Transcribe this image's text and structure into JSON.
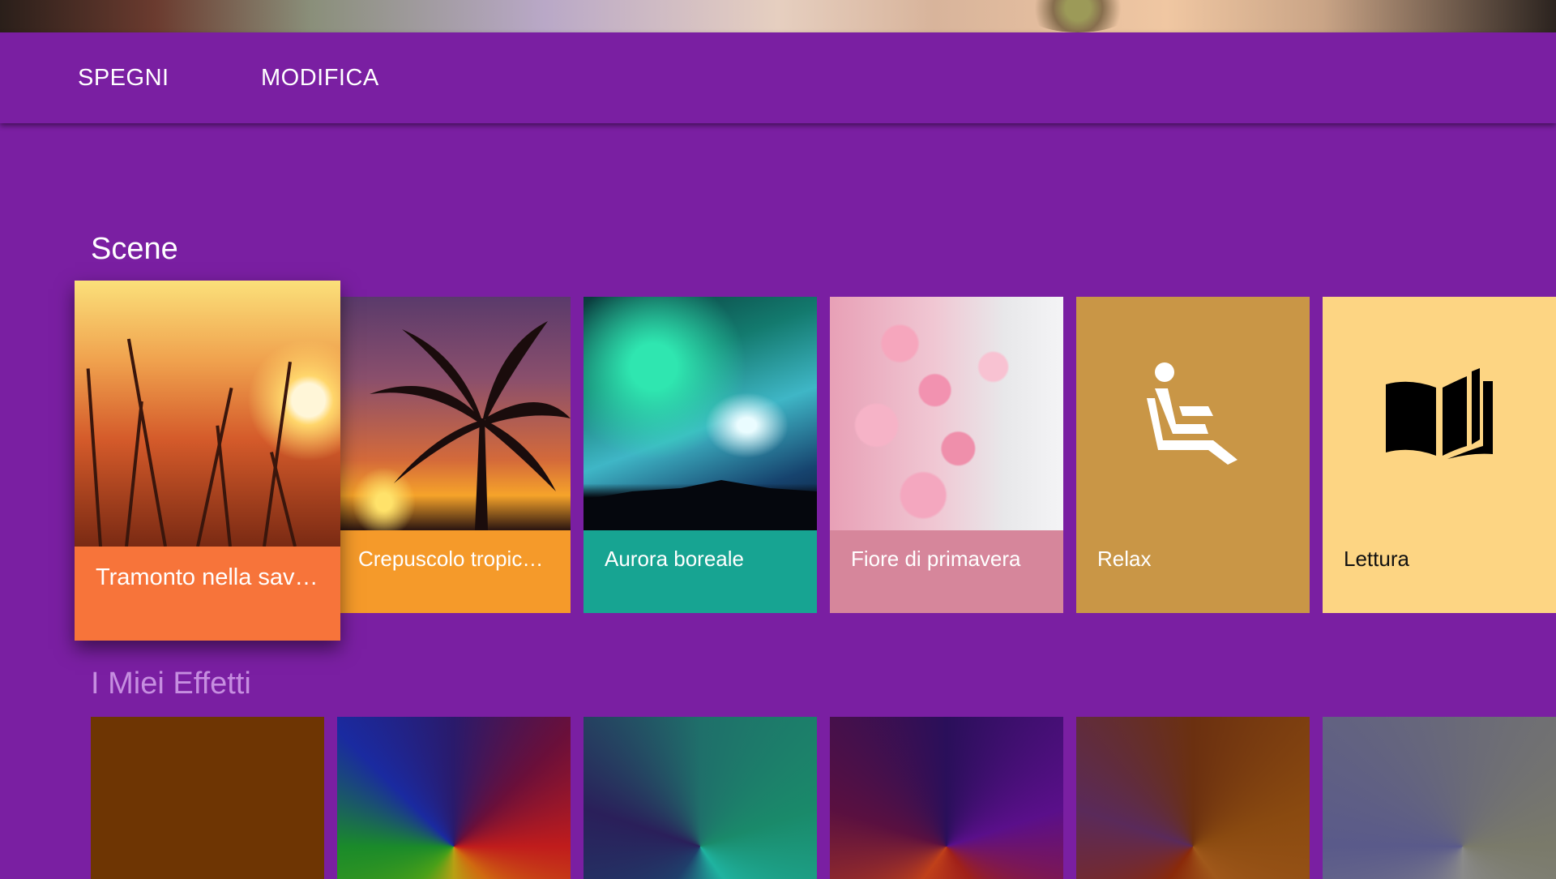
{
  "toolbar": {
    "off_label": "SPEGNI",
    "edit_label": "MODIFICA"
  },
  "scenes": {
    "title": "Scene",
    "items": [
      {
        "label": "Tramonto nella savana",
        "color": "#f7743a",
        "image": "savanna-sunset"
      },
      {
        "label": "Crepuscolo tropicale",
        "color": "#f59a2a",
        "image": "tropical-twilight-palm"
      },
      {
        "label": "Aurora boreale",
        "color": "#17a492",
        "image": "northern-lights"
      },
      {
        "label": "Fiore di primavera",
        "color": "#d6869b",
        "image": "cherry-blossom"
      },
      {
        "label": "Relax",
        "color": "#c99646",
        "icon": "armchair-person-icon"
      },
      {
        "label": "Lettura",
        "color": "#fdd583",
        "icon": "open-book-icon"
      }
    ]
  },
  "effects": {
    "title": "I Miei Effetti",
    "items": [
      {
        "color": "#6e3503"
      },
      {
        "color": "#3b1d7a"
      },
      {
        "color": "#1f6f6a"
      },
      {
        "color": "#3a1560"
      },
      {
        "color": "#6b3010"
      },
      {
        "color": "#6a6a78"
      }
    ]
  },
  "colors": {
    "background": "#7a1fa2",
    "effects_title": "#c68ee0"
  }
}
